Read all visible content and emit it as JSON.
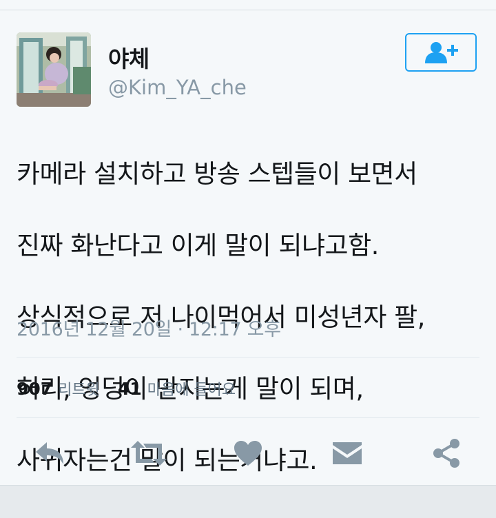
{
  "user": {
    "display_name": "야체",
    "username": "@Kim_YA_che"
  },
  "follow_button": {
    "icon": "add-user-icon"
  },
  "tweet": {
    "text_lines": [
      "카메라 설치하고 방송 스텝들이 보면서",
      "진짜 화난다고 이게 말이 되냐고함.",
      "상식적으로 저 나이먹어서 미성년자 팔,",
      "허리, 엉덩이 만지는게 말이 되며,",
      "사귀자는건 말이 되는거냐고."
    ],
    "timestamp": "2016년 12월 20일 · 12:17 오후"
  },
  "stats": {
    "retweets_count": "907",
    "retweets_label": "리트윗",
    "likes_count": "41",
    "likes_label": "마음에 들어요"
  },
  "actions": [
    "reply-icon",
    "retweet-icon",
    "heart-icon",
    "message-icon",
    "share-icon"
  ],
  "colors": {
    "accent": "#1da1f2",
    "icon_gray": "#8899a6",
    "text": "#14171a",
    "muted": "#8899a6"
  }
}
